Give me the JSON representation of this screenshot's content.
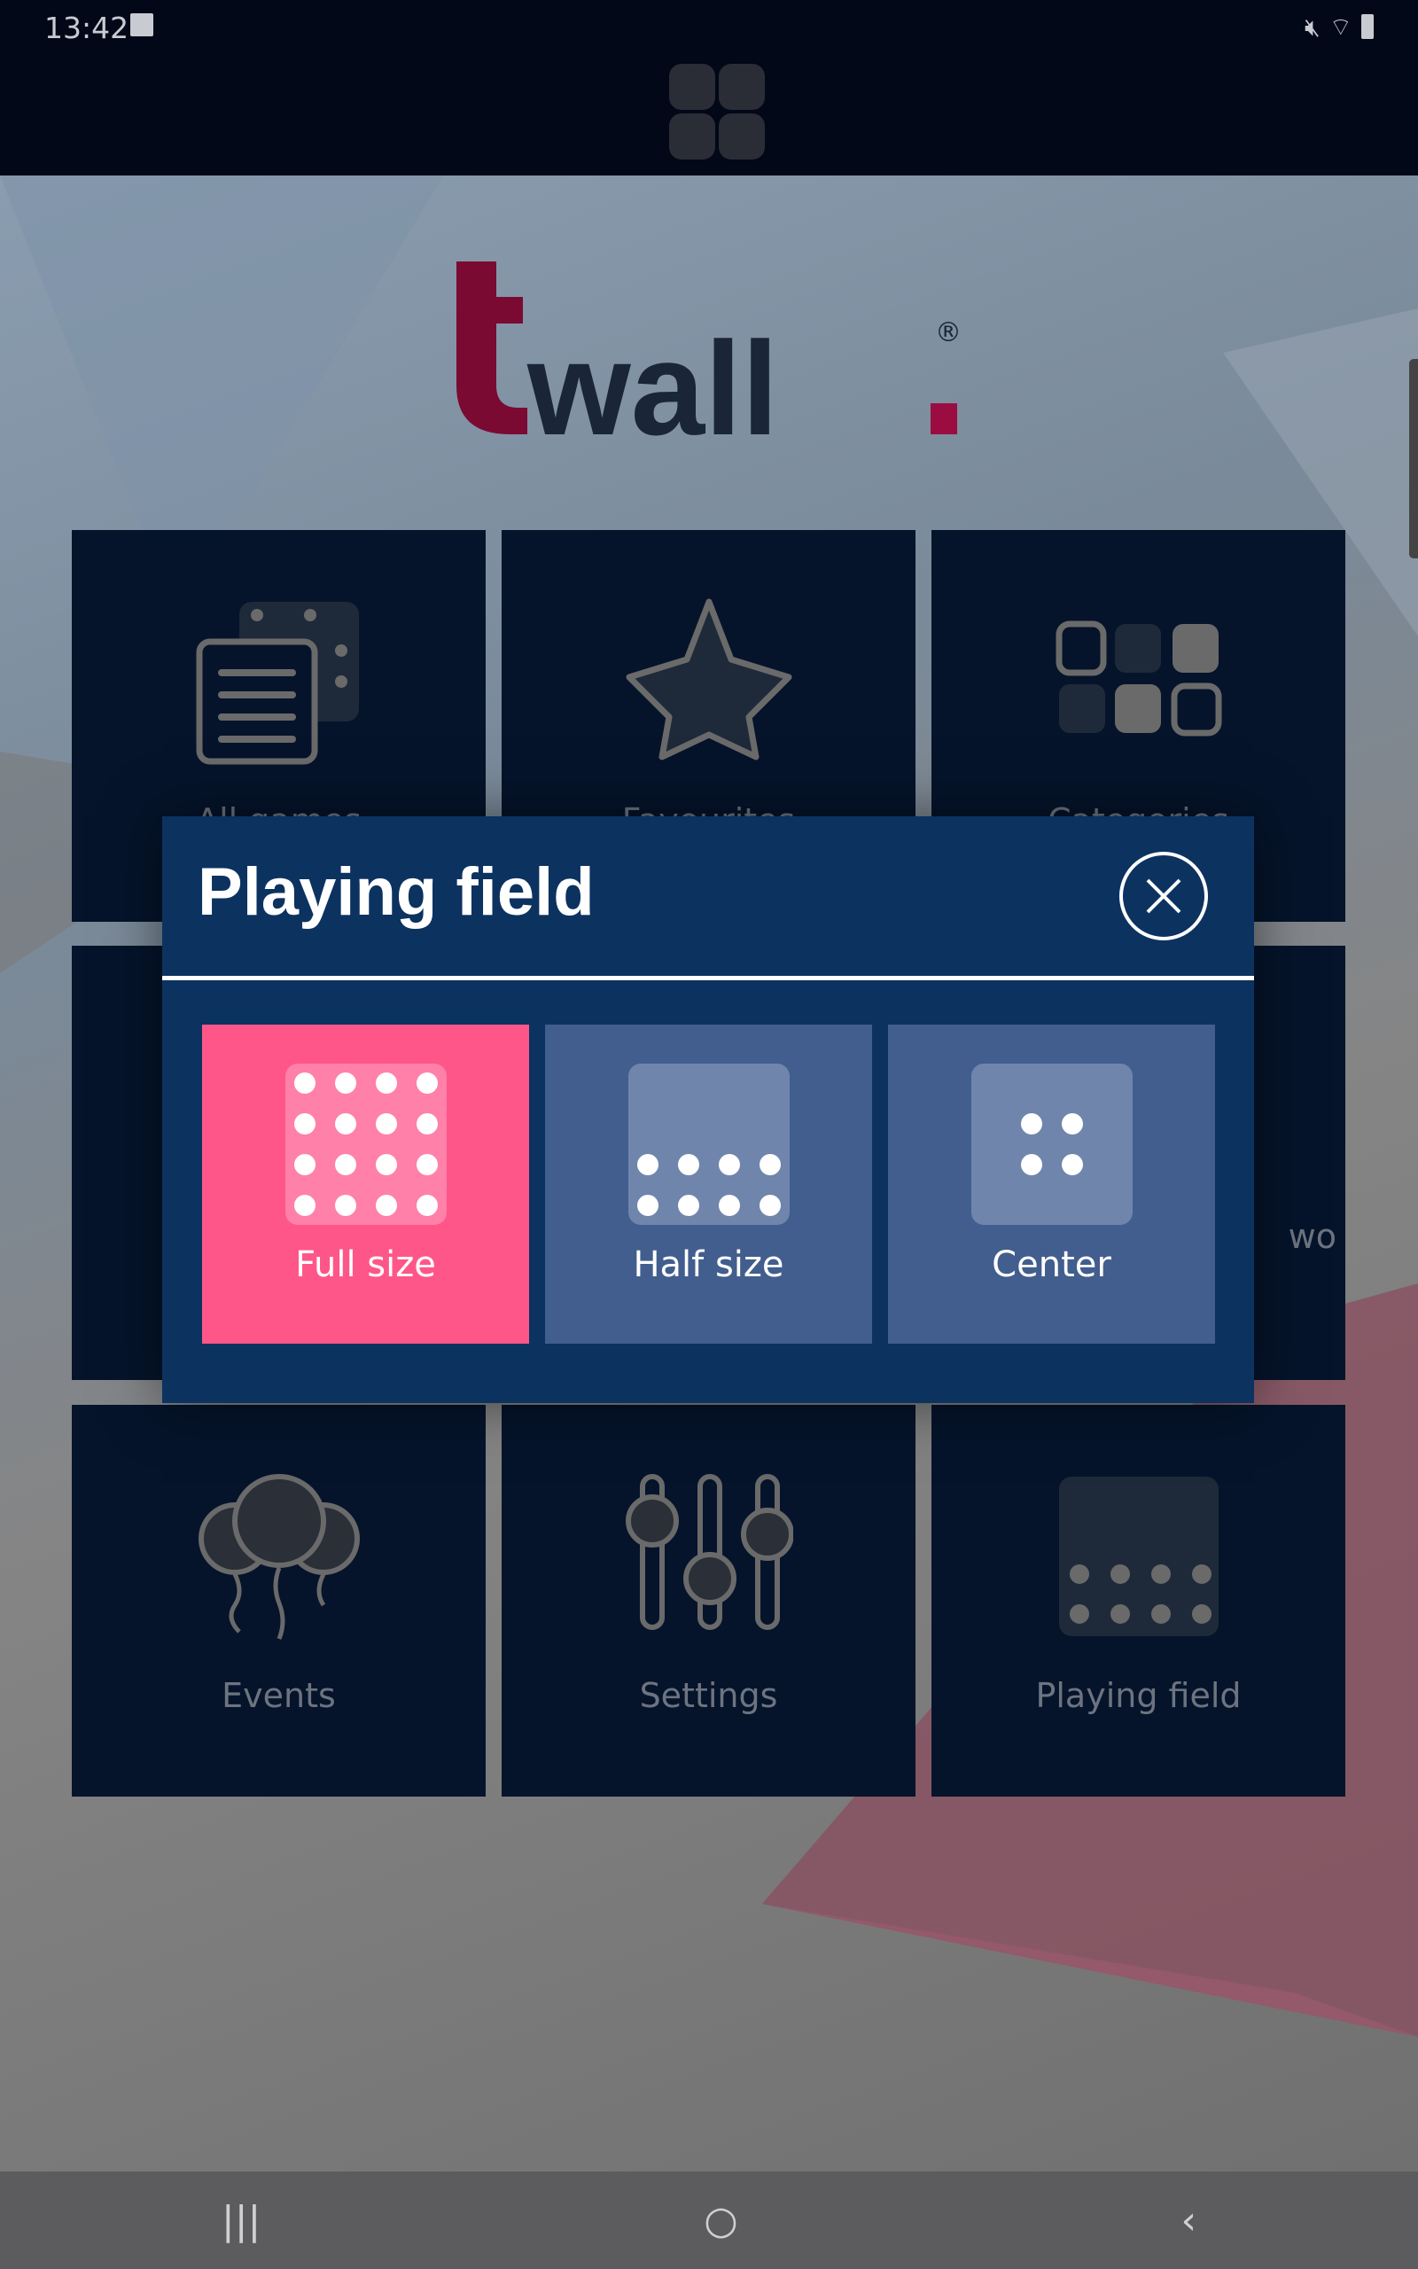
{
  "status_bar": {
    "time": "13:42",
    "icons": [
      "gallery-icon",
      "mute-icon",
      "wifi-icon",
      "battery-icon"
    ]
  },
  "app": {
    "logo_text": "twall.",
    "logo_mark": "®"
  },
  "tiles": [
    {
      "label": "All games",
      "icon": "cards-dice-icon"
    },
    {
      "label": "Favourites",
      "icon": "star-icon"
    },
    {
      "label": "Categories",
      "icon": "categories-grid-icon"
    },
    {
      "label": "",
      "icon": ""
    },
    {
      "label": "",
      "icon": ""
    },
    {
      "label": "wo",
      "icon": ""
    },
    {
      "label": "Events",
      "icon": "balloons-icon"
    },
    {
      "label": "Settings",
      "icon": "sliders-icon"
    },
    {
      "label": "Playing field",
      "icon": "playing-field-icon"
    }
  ],
  "modal": {
    "title": "Playing field",
    "close_icon": "close-circle-icon",
    "options": [
      {
        "label": "Full size",
        "selected": true
      },
      {
        "label": "Half size",
        "selected": false
      },
      {
        "label": "Center",
        "selected": false
      }
    ]
  },
  "colors": {
    "selected": "#ff5689",
    "option": "#425e8e",
    "modal": "#0c3260",
    "tile": "#05142b",
    "brand": "#8b0b3a"
  },
  "nav": {
    "recents": "|||",
    "home": "○",
    "back": "‹"
  }
}
